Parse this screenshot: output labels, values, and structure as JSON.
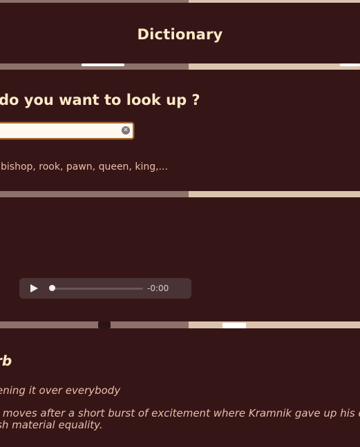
{
  "header": {
    "title": "Dictionary"
  },
  "search": {
    "question": "do you want to look up ?",
    "value": "",
    "placeholder": "",
    "hint": " bishop, rook, pawn, queen, king,..."
  },
  "audio": {
    "time": "-0:00",
    "progress": 0
  },
  "entry": {
    "part_of_speech": "rb",
    "definition": "ening it over everybody",
    "example_line1": "l moves after a short burst of excitement where Kramnik gave up his que",
    "example_line2": "sh material equality."
  },
  "colors": {
    "panel": "#361517",
    "heading": "#fde9c6",
    "body_text": "#e9bfa8",
    "board_dark": "#8d726b",
    "board_light": "#dbc3ad"
  }
}
